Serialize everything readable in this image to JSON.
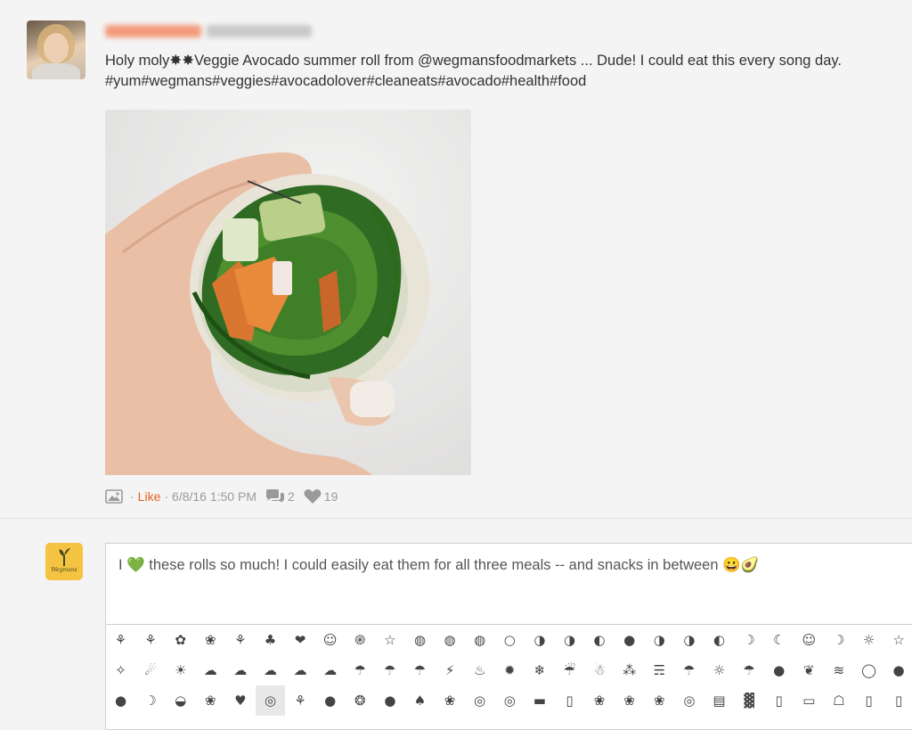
{
  "post": {
    "caption_line1": "Holy moly✸✸Veggie Avocado summer roll from @wegmansfoodmarkets ... Dude! I could eat this every song day.",
    "caption_line2": "#yum#wegmans#veggies#avocadolover#cleaneats#avocado#health#food",
    "like_label": "Like",
    "timestamp": "6/8/16 1:50 PM",
    "comment_count": "2",
    "like_count": "19",
    "separator": "·"
  },
  "reply": {
    "avatar_brand": "Wegmans",
    "comment_text": "I 💚 these rolls so much! I could easily eat them for all three meals -- and snacks in between 😀🥑"
  },
  "emoji_rows": [
    [
      "⚘",
      "⚘",
      "✿",
      "❀",
      "⚘",
      "♣",
      "❤",
      "☺",
      "֎",
      "☆",
      "◍",
      "◍",
      "◍",
      "○",
      "◑",
      "◑",
      "◐",
      "●",
      "◑",
      "◑",
      "◐",
      "☽",
      "☾",
      "☺",
      "☽",
      "☼",
      "☆"
    ],
    [
      "✧",
      "☄",
      "☀",
      "☁",
      "☁",
      "☁",
      "☁",
      "☁",
      "☂",
      "☂",
      "☂",
      "⚡",
      "♨",
      "✹",
      "❄",
      "☔",
      "☃",
      "⁂",
      "☴",
      "☂",
      "☼",
      "☂",
      "●",
      "❦",
      "≋",
      "◯",
      "●"
    ],
    [
      "●",
      "☽",
      "◒",
      "❀",
      "♥",
      "◎",
      "⚘",
      "●",
      "❂",
      "●",
      "♠",
      "❀",
      "◎",
      "◎",
      "▬",
      "▯",
      "❀",
      "❀",
      "❀",
      "◎",
      "▤",
      "▓",
      "▯",
      "▭",
      "☖",
      "▯",
      "▯"
    ]
  ]
}
